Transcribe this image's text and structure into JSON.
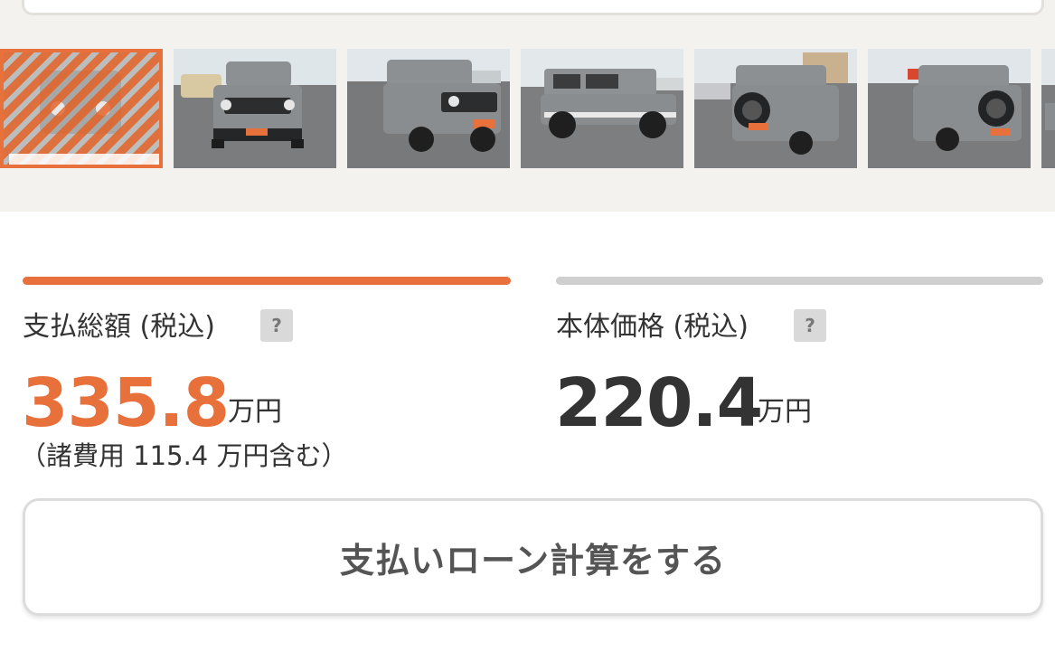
{
  "colors": {
    "accent": "#e8703a",
    "tab_inactive": "#cfcfcf",
    "gallery_bg": "#f3f2ef",
    "text": "#333333",
    "vehicle_body": "#8a8d8f"
  },
  "gallery": {
    "selected_index": 0,
    "thumbnails": [
      {
        "icon": "car-front-photo"
      },
      {
        "icon": "car-front-photo"
      },
      {
        "icon": "car-front-three-quarter-photo"
      },
      {
        "icon": "car-side-photo"
      },
      {
        "icon": "car-rear-three-quarter-photo"
      },
      {
        "icon": "car-rear-three-quarter-photo"
      },
      {
        "icon": "car-photo-partial"
      }
    ]
  },
  "prices": {
    "total": {
      "label": "支払総額 (税込)",
      "help": "?",
      "value": "335.8",
      "unit": "万円",
      "note": "（諸費用 115.4 万円含む）"
    },
    "base": {
      "label": "本体価格 (税込)",
      "help": "?",
      "value": "220.4",
      "unit": "万円"
    }
  },
  "loan_button": {
    "label": "支払いローン計算をする"
  }
}
